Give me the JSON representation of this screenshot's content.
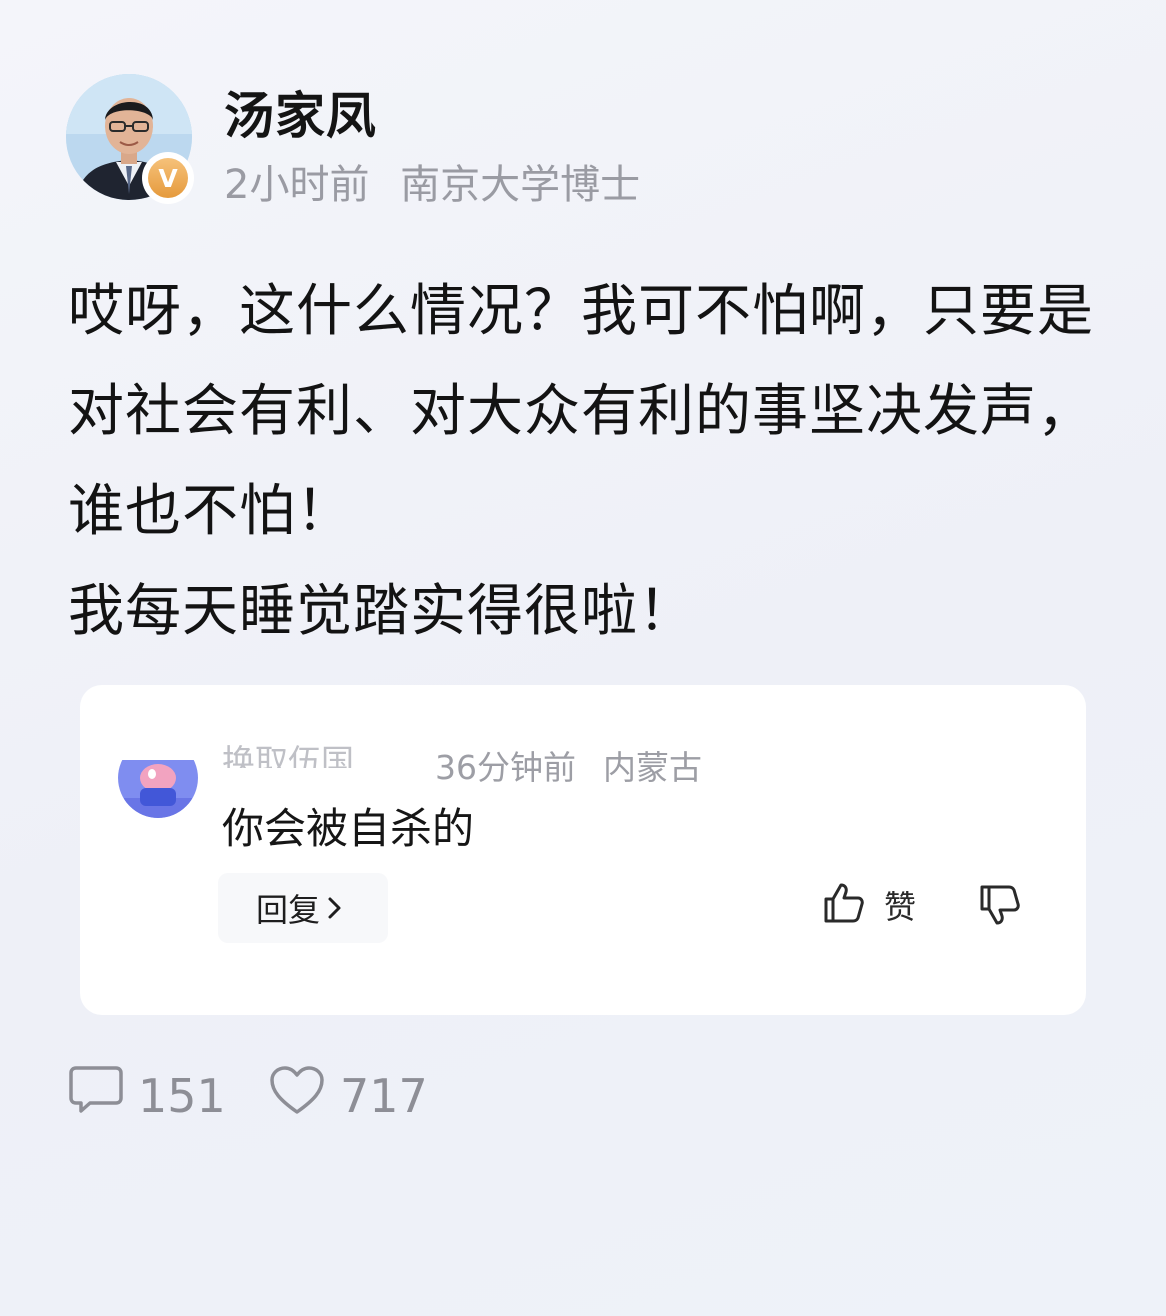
{
  "author": {
    "name": "汤家凤",
    "time": "2小时前",
    "title": "南京大学博士",
    "verified_badge": "V",
    "badge_color": "#e59a3c"
  },
  "post": {
    "paragraphs": [
      "哎呀，这什么情况？我可不怕啊，只要是对社会有利、对大众有利的事坚决发声，谁也不怕！",
      "我每天睡觉踏实得很啦！"
    ]
  },
  "comment": {
    "name": "换取伍国",
    "time": "36分钟前",
    "location": "内蒙古",
    "text": "你会被自杀的",
    "reply_label": "回复",
    "like_label": "赞"
  },
  "stats": {
    "comment_count": "151",
    "like_count": "717"
  },
  "icons": {
    "comment": "comment-bubble-icon",
    "heart": "heart-icon",
    "thumbs_up": "thumbs-up-icon",
    "thumbs_down": "thumbs-down-icon",
    "chevron": "chevron-right-icon"
  },
  "colors": {
    "background": "#f1f3f9",
    "card": "#ffffff",
    "meta_text": "#9a9ba3"
  }
}
